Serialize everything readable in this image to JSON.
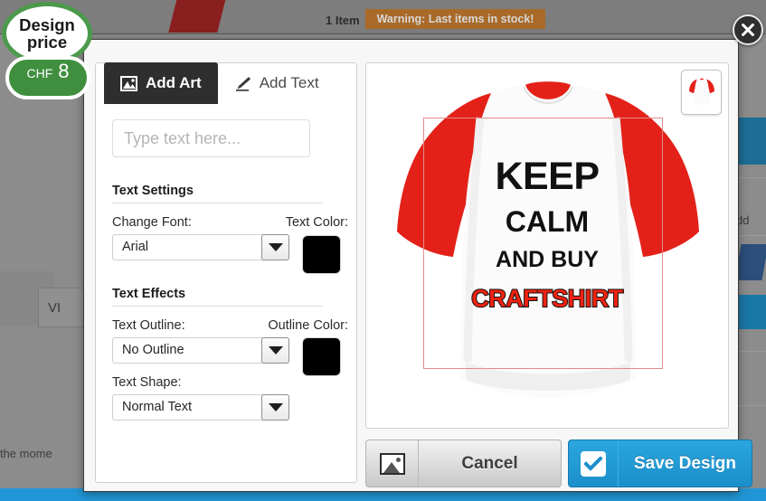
{
  "background": {
    "item_count": "1 Item",
    "warning": "Warning: Last items in stock!",
    "view_button": "VI",
    "moment_text": "r the mome",
    "add_label": "dd"
  },
  "price_badge": {
    "title_line1": "Design",
    "title_line2": "price",
    "currency": "CHF",
    "amount": "8"
  },
  "modal": {
    "close_icon": "close-icon",
    "tabs": [
      {
        "label": "Add Art",
        "icon": "image-icon",
        "active": true
      },
      {
        "label": "Add Text",
        "icon": "pen-icon",
        "active": false
      }
    ],
    "text_input": {
      "value": "",
      "placeholder": "Type text here..."
    },
    "sections": [
      {
        "title": "Text Settings",
        "fields": [
          {
            "label": "Change Font:",
            "value": "Arial",
            "color_label": "Text Color:",
            "color_value": "#000000"
          }
        ]
      },
      {
        "title": "Text Effects",
        "fields": [
          {
            "label": "Text Outline:",
            "value": "No Outline",
            "color_label": "Outline Color:",
            "color_value": "#000000"
          },
          {
            "label": "Text Shape:",
            "value": "Normal Text"
          }
        ]
      }
    ],
    "preview": {
      "garment": "raglan-tshirt-red-white",
      "thumbnail_icon": "tshirt-thumbnail-icon",
      "design_lines": [
        {
          "text": "KEEP",
          "color": "#111111",
          "outline": "none"
        },
        {
          "text": "CALM",
          "color": "#111111",
          "outline": "none"
        },
        {
          "text": "AND BUY",
          "color": "#111111",
          "outline": "none"
        },
        {
          "text": "CRAFTSHIRT",
          "color": "#ee2211",
          "outline": "#111111"
        }
      ],
      "boundary_color": "#e58a8a"
    },
    "footer": {
      "cancel_label": "Cancel",
      "cancel_icon": "image-icon",
      "save_label": "Save Design",
      "save_icon": "check-icon",
      "save_color": "#1b8fcb"
    }
  }
}
